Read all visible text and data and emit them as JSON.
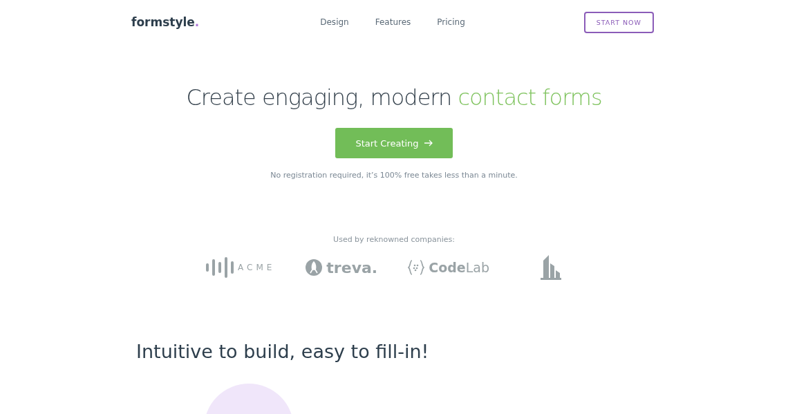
{
  "nav": {
    "brand": "formstyle",
    "brand_dot": ".",
    "links": [
      {
        "label": "Design"
      },
      {
        "label": "Features"
      },
      {
        "label": "Pricing"
      }
    ],
    "cta": "START NOW"
  },
  "hero": {
    "headline": "Create engaging, modern",
    "headline_highlight": "contact forms",
    "button": "Start Creating",
    "note": "No registration required, it’s 100% free takes less than a minute."
  },
  "companies": {
    "caption": "Used by reknowned companies:",
    "logos": [
      {
        "kind": "bars",
        "name": "ACME"
      },
      {
        "kind": "circle",
        "name": "treva."
      },
      {
        "kind": "braces",
        "name": "Code",
        "name_light": "Lab"
      },
      {
        "kind": "building"
      }
    ]
  },
  "section": {
    "title": "Intuitive to build, easy to fill-in!"
  }
}
